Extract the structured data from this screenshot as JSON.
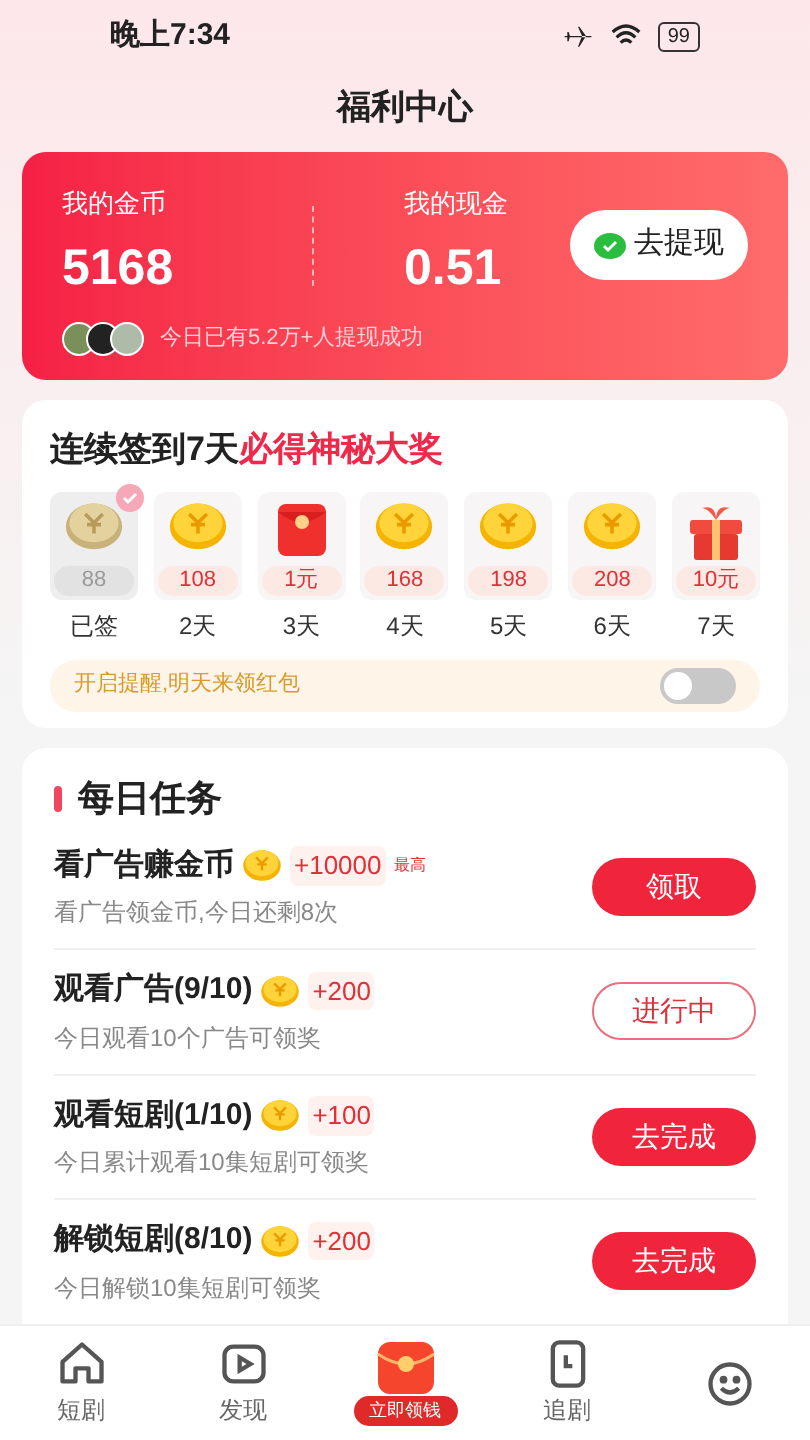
{
  "status_bar": {
    "time": "晚上7:34",
    "battery": "99"
  },
  "title": "福利中心",
  "wallet": {
    "coins_label": "我的金币",
    "coins": "5168",
    "cash_label": "我的现金",
    "cash": "0.51",
    "withdraw_button": "去提现",
    "note": "今日已有5.2万+人提现成功"
  },
  "checkin": {
    "title": "连续签到7天",
    "title_highlight": "必得神秘大奖",
    "days": [
      {
        "kind": "coin",
        "amount": "88",
        "label": "已签",
        "signed": true
      },
      {
        "kind": "coin",
        "amount": "108",
        "label": "2天",
        "signed": false
      },
      {
        "kind": "redpacket",
        "amount": "1元",
        "label": "3天",
        "signed": false
      },
      {
        "kind": "coin",
        "amount": "168",
        "label": "4天",
        "signed": false
      },
      {
        "kind": "coin",
        "amount": "198",
        "label": "5天",
        "signed": false
      },
      {
        "kind": "coin",
        "amount": "208",
        "label": "6天",
        "signed": false
      },
      {
        "kind": "gift",
        "amount": "10元",
        "label": "7天",
        "signed": false
      }
    ],
    "reminder": {
      "label": "开启提醒,明天来领红包",
      "on": false
    }
  },
  "tasks": {
    "title": "每日任务",
    "items": [
      {
        "name": "看广告赚金币",
        "reward": "+10000",
        "reward_note": "最高",
        "desc": "看广告领金币,今日还剩8次",
        "button": "领取",
        "kind": "filled"
      },
      {
        "name": "观看广告(9/10)",
        "reward": "+200",
        "desc": "今日观看10个广告可领奖",
        "button": "进行中",
        "kind": "outline"
      },
      {
        "name": "观看短剧(1/10)",
        "reward": "+100",
        "desc": "今日累计观看10集短剧可领奖",
        "button": "去完成",
        "kind": "filled"
      },
      {
        "name": "解锁短剧(8/10)",
        "reward": "+200",
        "desc": "今日解锁10集短剧可领奖",
        "button": "去完成",
        "kind": "filled"
      }
    ]
  },
  "nav": [
    {
      "kind": "home",
      "label": "短剧",
      "selected": false
    },
    {
      "kind": "play",
      "label": "发现",
      "selected": false
    },
    {
      "kind": "center",
      "label": "立即领钱",
      "selected": true
    },
    {
      "kind": "phone",
      "label": "追剧",
      "selected": false
    },
    {
      "kind": "smile",
      "selected": false
    }
  ]
}
